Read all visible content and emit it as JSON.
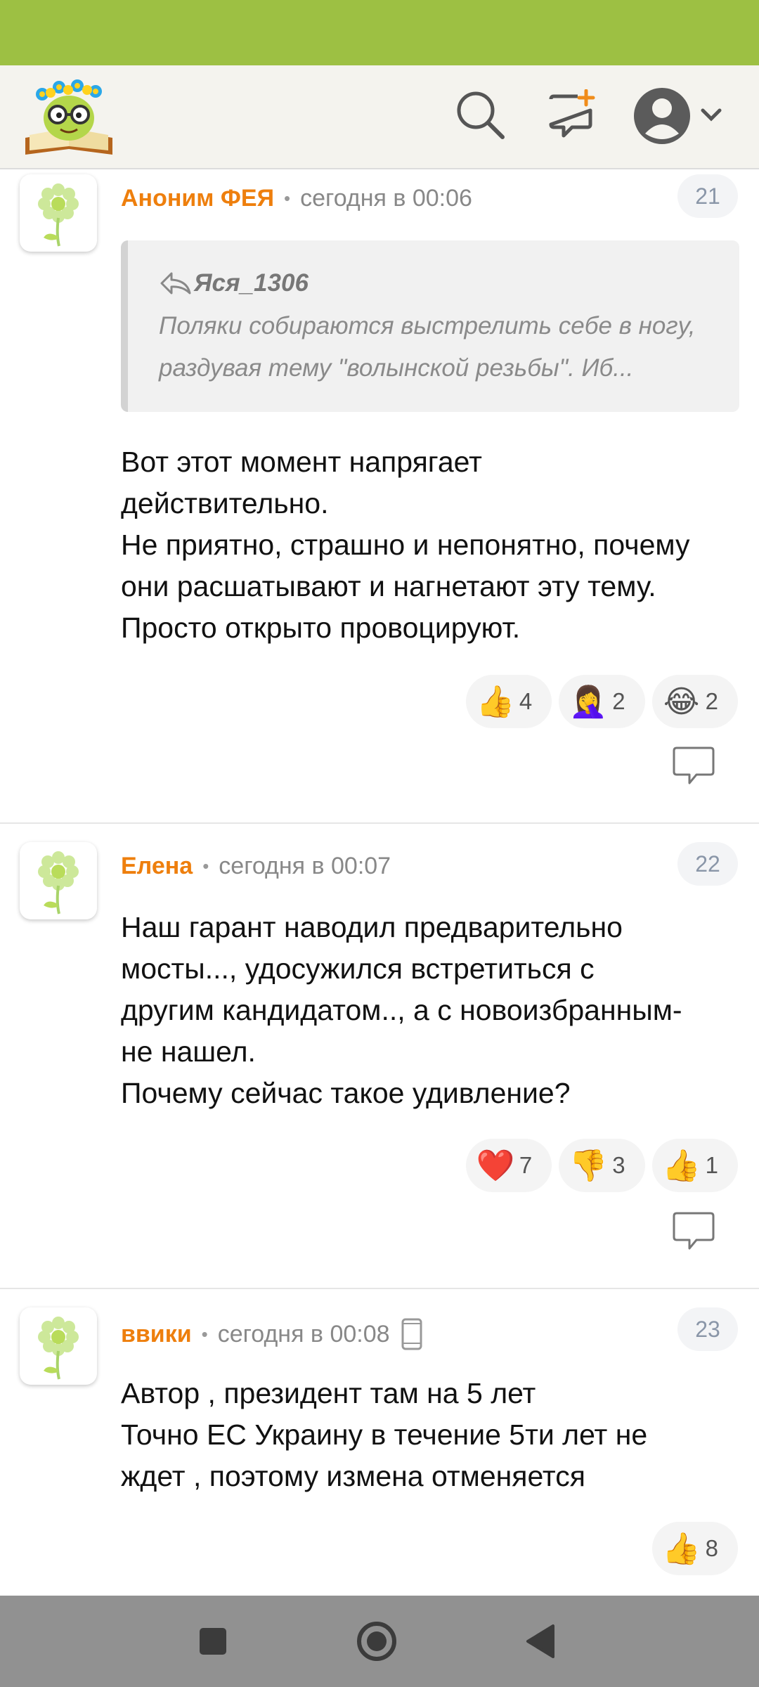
{
  "header": {
    "logo_icon": "smiling-book-with-flowers-logo",
    "search_icon": "search-icon",
    "new_post_icon": "new-message-plus-icon",
    "profile_icon": "user-avatar-icon",
    "menu_icon": "chevron-down-icon"
  },
  "colors": {
    "status_bar": "#9dc043",
    "author": "#ee7f0d",
    "meta_text": "#888888"
  },
  "comments": [
    {
      "author": "Аноним ФЕЯ",
      "time": "сегодня в 00:06",
      "number": "21",
      "quote": {
        "author": "Яся_1306",
        "lines": [
          "Поляки собираются выстрелить себе в ногу,",
          "раздувая тему \"волынской резьбы\". Иб..."
        ]
      },
      "lines": [
        "Вот этот момент напрягает",
        "действительно.",
        "Не приятно, страшно и непонятно, почему",
        "они расшатывают и нагнетают эту тему.",
        "Просто открыто провоцируют."
      ],
      "reactions": [
        {
          "emoji": "👍",
          "count": "4",
          "icon": "thumbs-up-icon"
        },
        {
          "emoji": "🤦‍♀️",
          "count": "2",
          "icon": "facepalm-icon"
        },
        {
          "emoji": "😂",
          "count": "2",
          "icon": "laughing-tears-icon"
        }
      ]
    },
    {
      "author": "Елена",
      "time": "сегодня в 00:07",
      "number": "22",
      "lines": [
        "Наш гарант наводил предварительно",
        "мосты..., удосужился встретиться с",
        "другим кандидатом.., а с новоизбранным-",
        "не нашел.",
        "Почему сейчас такое удивление?"
      ],
      "reactions": [
        {
          "emoji": "❤️",
          "count": "7",
          "icon": "heart-icon"
        },
        {
          "emoji": "👎",
          "count": "3",
          "icon": "thumbs-down-icon"
        },
        {
          "emoji": "👍",
          "count": "1",
          "icon": "thumbs-up-icon"
        }
      ]
    },
    {
      "author": "ввики",
      "time": "сегодня в 00:08",
      "number": "23",
      "device_icon": "mobile-phone-icon",
      "lines": [
        "Автор , президент там на 5 лет",
        "Точно ЕС Украину в течение 5ти лет не",
        "ждет , поэтому измена отменяется"
      ],
      "reactions": [
        {
          "emoji": "👍",
          "count": "8",
          "icon": "thumbs-up-icon"
        }
      ]
    }
  ],
  "navbar": {
    "recents_icon": "square-recents-icon",
    "home_icon": "circle-home-icon",
    "back_icon": "triangle-back-icon"
  }
}
